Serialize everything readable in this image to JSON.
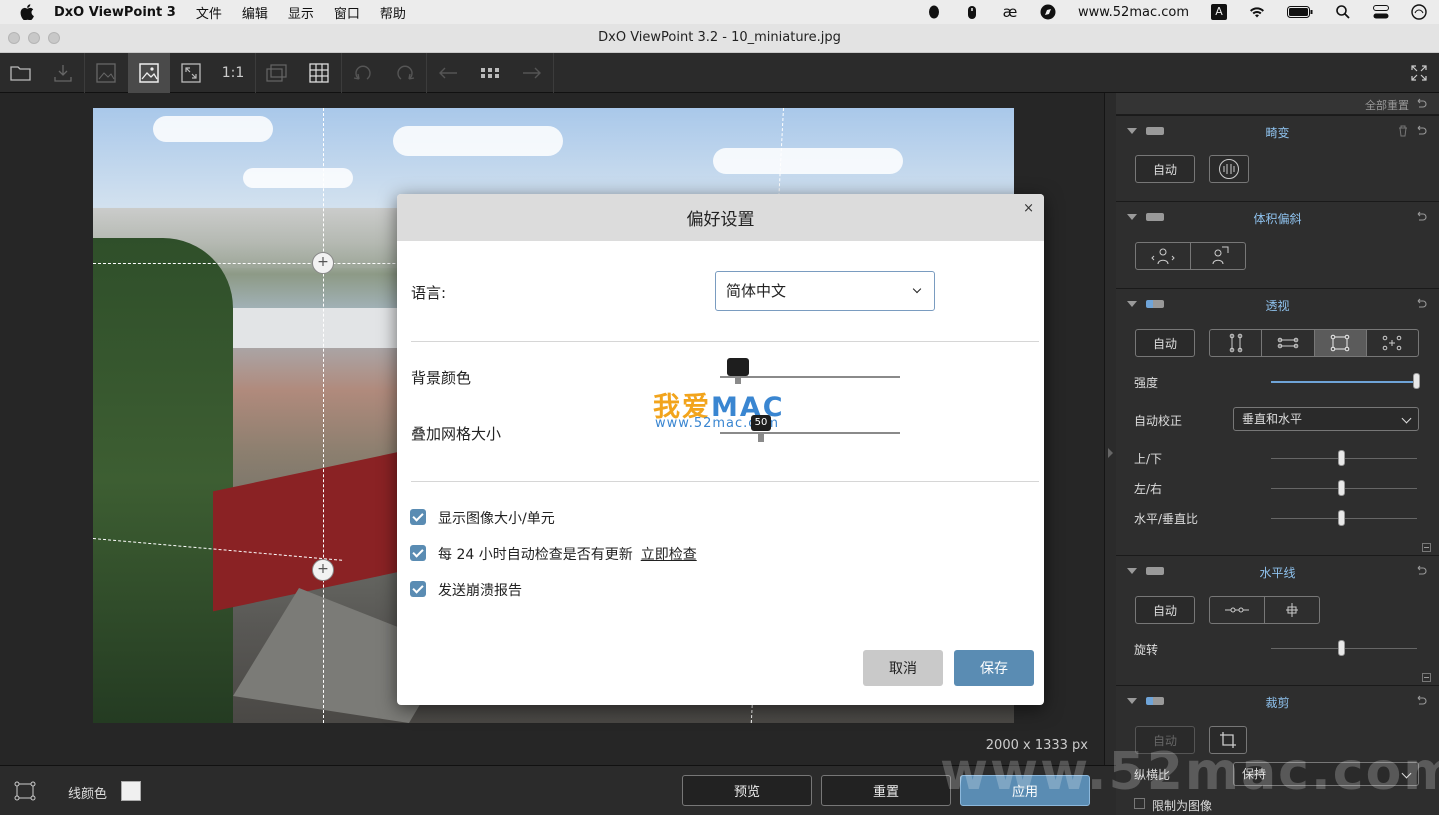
{
  "menubar": {
    "app_name": "DxO ViewPoint 3",
    "items": [
      "文件",
      "编辑",
      "显示",
      "窗口",
      "帮助"
    ],
    "status_text": "www.52mac.com",
    "input_indicator": "A"
  },
  "window": {
    "title": "DxO ViewPoint 3.2 - 10_miniature.jpg"
  },
  "toolbar": {
    "one_to_one": "1:1"
  },
  "canvas": {
    "image_size": "2000 x 1333 px"
  },
  "panel": {
    "reset_all": "全部重置",
    "distortion": {
      "title": "畸变",
      "auto": "自动"
    },
    "volume": {
      "title": "体积偏斜"
    },
    "perspective": {
      "title": "透视",
      "auto": "自动",
      "intensity_label": "强度",
      "auto_correct_label": "自动校正",
      "auto_correct_value": "垂直和水平",
      "updown_label": "上/下",
      "leftright_label": "左/右",
      "ratio_label": "水平/垂直比"
    },
    "horizon": {
      "title": "水平线",
      "auto": "自动",
      "rotate_label": "旋转"
    },
    "crop": {
      "title": "裁剪",
      "auto": "自动",
      "ratio_label": "纵横比",
      "ratio_value": "保持",
      "constrain_label": "限制为图像"
    }
  },
  "bottombar": {
    "line_color_label": "线颜色",
    "preview": "预览",
    "reset": "重置",
    "apply": "应用"
  },
  "watermark": {
    "big": "www.52mac.com",
    "logo_cn": "我爱",
    "logo_mac": "MAC",
    "logo_url": "www.52mac.com"
  },
  "dialog": {
    "title": "偏好设置",
    "close": "×",
    "language_label": "语言:",
    "language_value": "简体中文",
    "bg_color_label": "背景颜色",
    "grid_size_label": "叠加网格大小",
    "grid_size_value": "50",
    "checkboxes": [
      {
        "label": "显示图像大小/单元",
        "checked": true
      },
      {
        "label": "每 24 小时自动检查是否有更新",
        "link": "立即检查",
        "checked": true
      },
      {
        "label": "发送崩溃报告",
        "checked": true
      }
    ],
    "cancel": "取消",
    "save": "保存"
  },
  "colors": {
    "accent": "#5a8cb3",
    "panel_title": "#8fc2ee",
    "panel_bg": "#2e2e2e"
  }
}
